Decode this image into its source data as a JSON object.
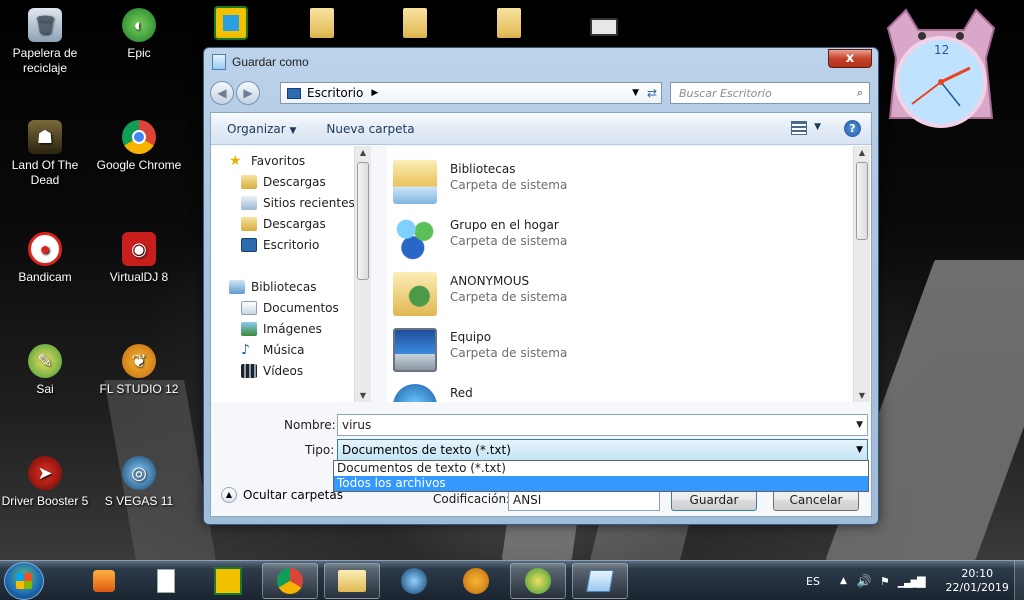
{
  "desktop": {
    "icons": [
      {
        "label": "Papelera de reciclaje",
        "icon": "recycle-bin-icon"
      },
      {
        "label": "Epic",
        "icon": "epic-icon"
      },
      {
        "label": "Land Of The Dead",
        "icon": "game-icon"
      },
      {
        "label": "Google Chrome",
        "icon": "chrome-icon"
      },
      {
        "label": "Bandicam",
        "icon": "bandicam-icon"
      },
      {
        "label": "VirtualDJ 8",
        "icon": "virtualdj-icon"
      },
      {
        "label": "Sai",
        "icon": "sai-icon"
      },
      {
        "label": "FL STUDIO 12",
        "icon": "fl-studio-icon"
      },
      {
        "label": "Driver Booster 5",
        "icon": "driver-booster-icon"
      },
      {
        "label": "S VEGAS 11",
        "icon": "vegas-icon"
      }
    ]
  },
  "dialog": {
    "title": "Guardar como",
    "close_label": "x",
    "address": "Escritorio",
    "search_placeholder": "Buscar Escritorio",
    "toolbar": {
      "organize": "Organizar",
      "new_folder": "Nueva carpeta"
    },
    "nav": {
      "favorites_header": "Favoritos",
      "favorites": [
        "Descargas",
        "Sitios recientes",
        "Descargas",
        "Escritorio"
      ],
      "libraries_header": "Bibliotecas",
      "libraries": [
        "Documentos",
        "Imágenes",
        "Música",
        "Vídeos"
      ]
    },
    "files": [
      {
        "name": "Bibliotecas",
        "type": "Carpeta de sistema",
        "icon": "libraries-folder-icon"
      },
      {
        "name": "Grupo en el hogar",
        "type": "Carpeta de sistema",
        "icon": "homegroup-icon"
      },
      {
        "name": "ANONYMOUS",
        "type": "Carpeta de sistema",
        "icon": "user-folder-icon"
      },
      {
        "name": "Equipo",
        "type": "Carpeta de sistema",
        "icon": "computer-icon"
      },
      {
        "name": "Red",
        "type": "",
        "icon": "network-icon"
      }
    ],
    "form": {
      "name_label": "Nombre:",
      "name_value": "virus",
      "type_label": "Tipo:",
      "type_value": "Documentos de texto (*.txt)",
      "type_options": [
        "Documentos de texto (*.txt)",
        "Todos los archivos"
      ],
      "encoding_label": "Codificación:",
      "encoding_value": "ANSI"
    },
    "hide_folders": "Ocultar carpetas",
    "save": "Guardar",
    "cancel": "Cancelar"
  },
  "taskbar": {
    "language": "ES",
    "time": "20:10",
    "date": "22/01/2019"
  },
  "colors": {
    "dialog_frame": "#a9c4e0",
    "selection": "#3399ff",
    "close_red": "#c7432b"
  }
}
